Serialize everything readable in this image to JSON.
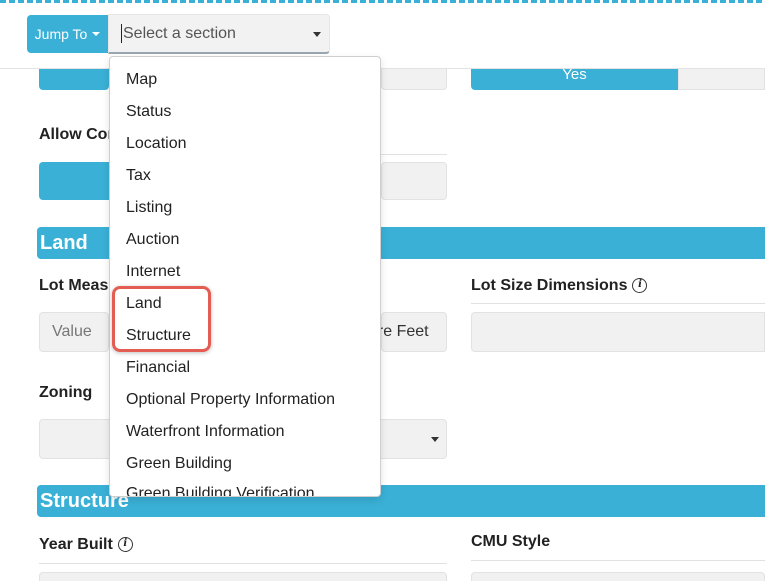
{
  "toolbar": {
    "jump_label": "Jump To",
    "section_placeholder": "Select a section"
  },
  "sections": {
    "yes_text": "Yes",
    "allow_label": "Allow Con",
    "land_title": "Land",
    "lot_measure_label": "Lot Measu",
    "lot_value_placeholder": "Value",
    "lot_unit_value": "are Feet",
    "lot_size_dim_label": "Lot Size Dimensions",
    "zoning_label": "Zoning",
    "structure_title": "Structure",
    "year_built_label": "Year Built",
    "cmu_style_label": "CMU Style"
  },
  "dropdown": {
    "items": [
      "Map",
      "Status",
      "Location",
      "Tax",
      "Listing",
      "Auction",
      "Internet",
      "Land",
      "Structure",
      "Financial",
      "Optional Property Information",
      "Waterfront Information",
      "Green Building",
      "Green Building Verification"
    ],
    "highlighted": [
      "Land",
      "Structure"
    ]
  },
  "colors": {
    "accent": "#3ab0d6",
    "highlight": "#e35d52"
  }
}
